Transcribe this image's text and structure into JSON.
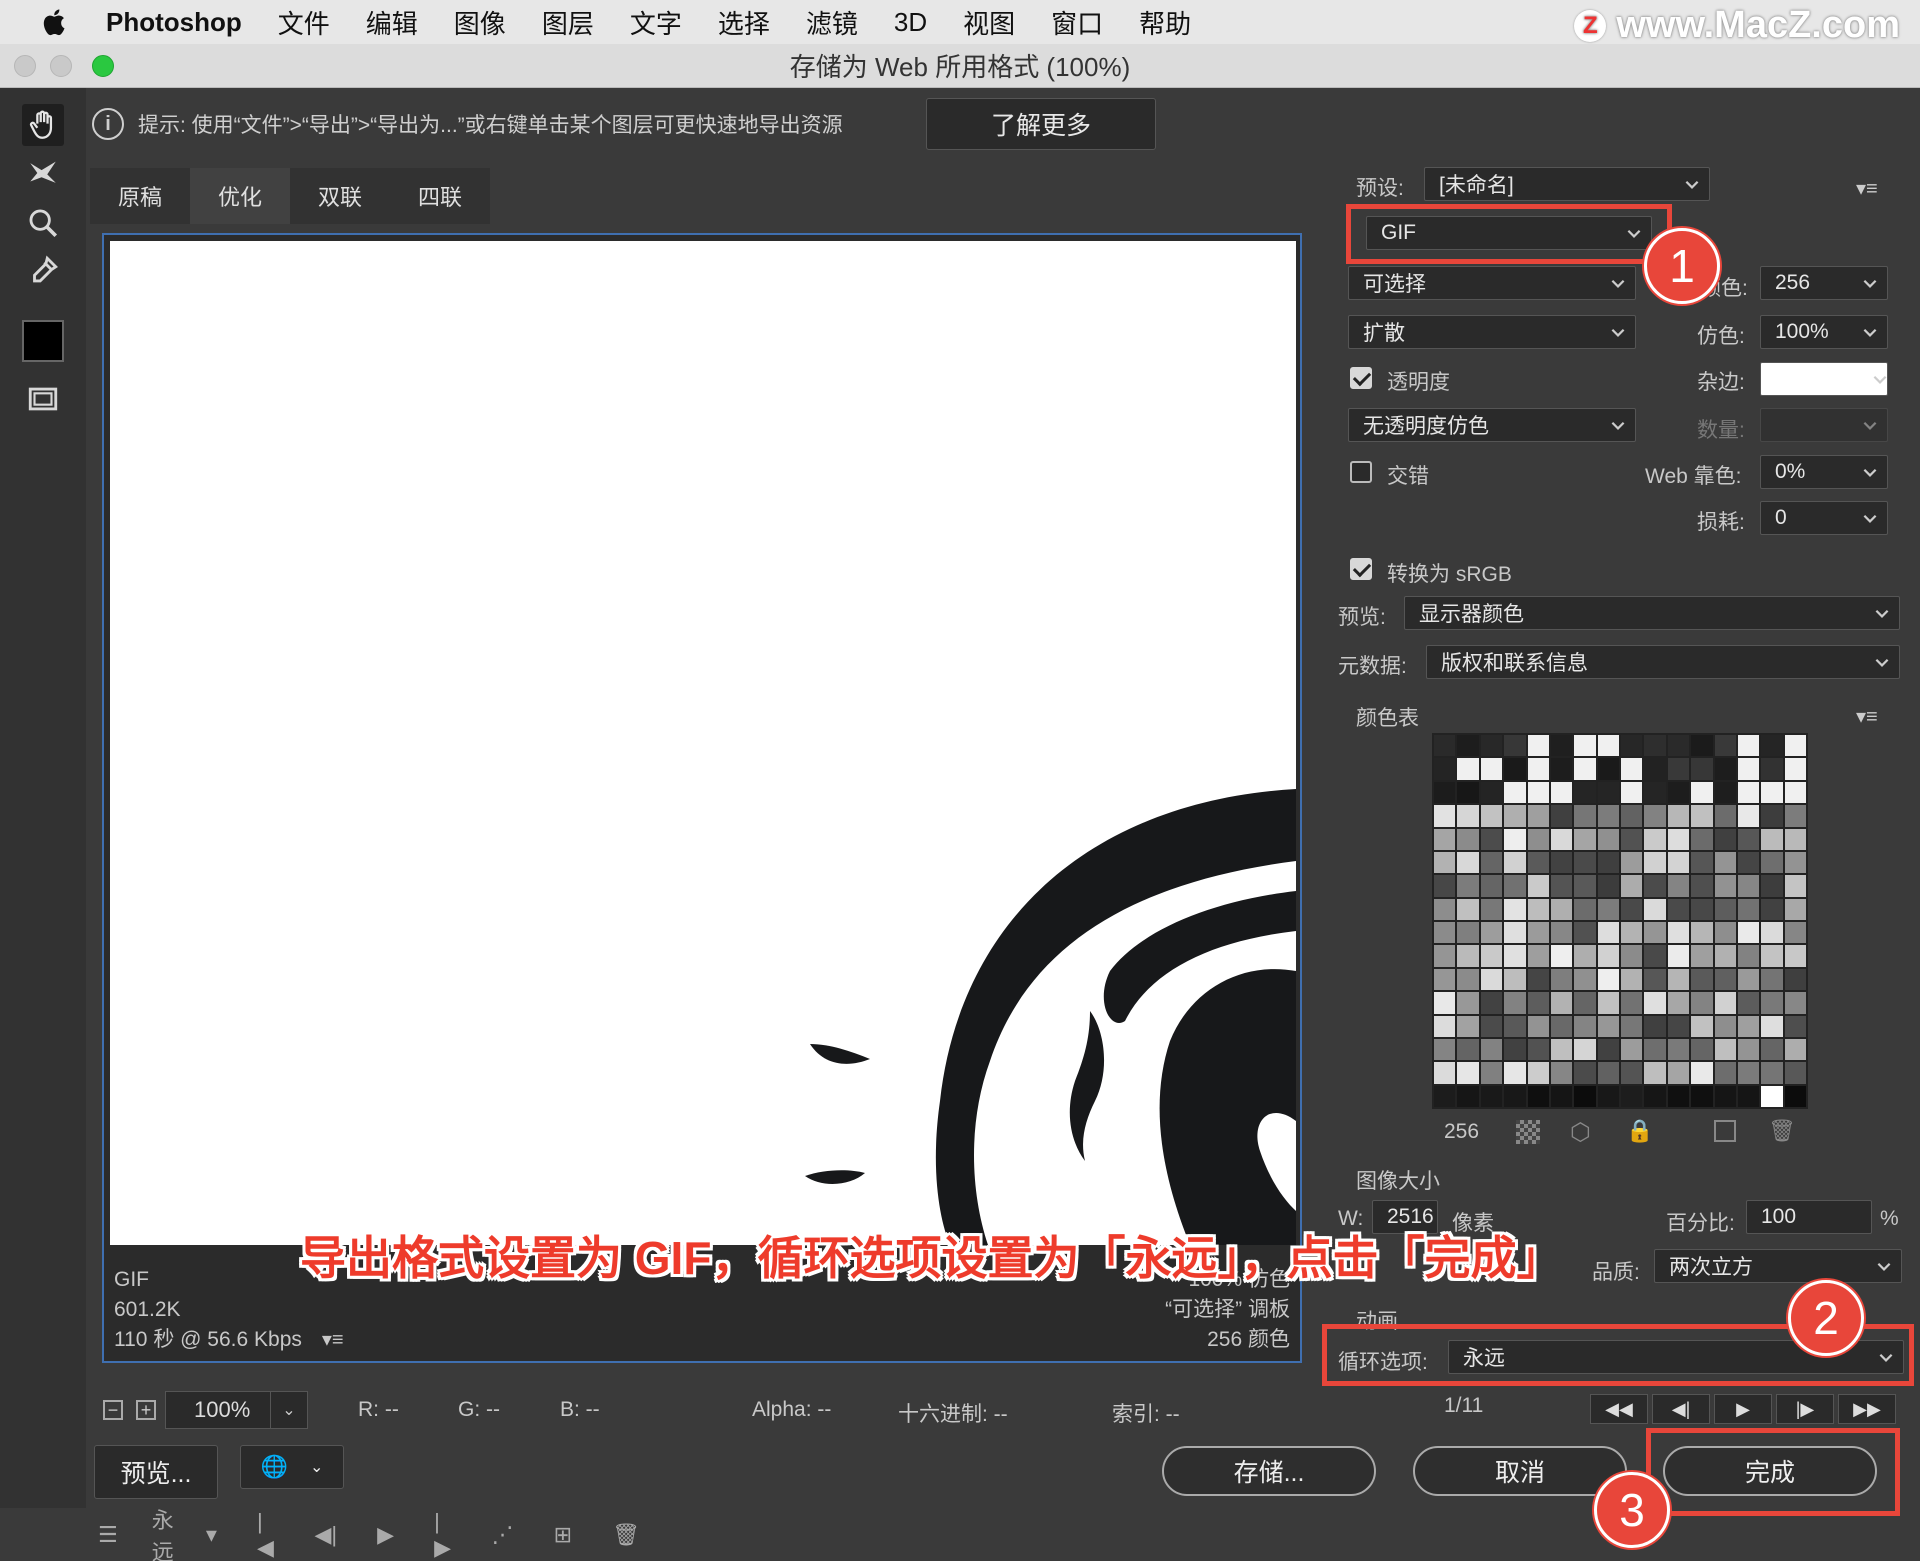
{
  "menubar": {
    "app": "Photoshop",
    "items": [
      "文件",
      "编辑",
      "图像",
      "图层",
      "文字",
      "选择",
      "滤镜",
      "3D",
      "视图",
      "窗口",
      "帮助"
    ],
    "watermark": "www.MacZ.com",
    "watermark_logo": "Z"
  },
  "window": {
    "title": "存储为 Web 所用格式 (100%)"
  },
  "hint": {
    "text": "提示: 使用“文件”>“导出”>“导出为...”或右键单击某个图层可更快速地导出资源",
    "button": "了解更多"
  },
  "tabs": [
    "原稿",
    "优化",
    "双联",
    "四联"
  ],
  "preview": {
    "format": "GIF",
    "size": "601.2K",
    "time": "110 秒 @ 56.6 Kbps",
    "right_line1": "100% 仿色",
    "right_line2": "“可选择” 调板",
    "right_line3": "256 颜色"
  },
  "caption": "导出格式设置为 GIF，循环选项设置为「永远」，点击「完成」",
  "status": {
    "zoom": "100%",
    "r": "R: --",
    "g": "G: --",
    "b": "B: --",
    "alpha": "Alpha: --",
    "hex": "十六进制: --",
    "index": "索引: --"
  },
  "buttons": {
    "preview": "预览...",
    "save": "存储...",
    "cancel": "取消",
    "done": "完成"
  },
  "settings": {
    "preset_label": "预设:",
    "preset_value": "[未命名]",
    "format": "GIF",
    "reduction": "可选择",
    "colors_label": "颜色:",
    "colors_value": "256",
    "dither_algo": "扩散",
    "dither_label": "仿色:",
    "dither_value": "100%",
    "transparency_label": "透明度",
    "matte_label": "杂边:",
    "trans_dither": "无透明度仿色",
    "amount_label": "数量:",
    "interlaced_label": "交错",
    "websnap_label": "Web 靠色:",
    "websnap_value": "0%",
    "lossy_label": "损耗:",
    "lossy_value": "0",
    "srgb_label": "转换为 sRGB",
    "preview_label": "预览:",
    "preview_value": "显示器颜色",
    "metadata_label": "元数据:",
    "metadata_value": "版权和联系信息",
    "colortable_label": "颜色表",
    "colortable_count": "256",
    "imagesize_label": "图像大小",
    "w_label": "W:",
    "w_value": "2516",
    "pixel_label": "像素",
    "percent_label": "百分比:",
    "percent_value": "100",
    "percent_unit": "%",
    "quality_label": "品质:",
    "quality_value": "两次立方",
    "anim_label": "动画",
    "loop_label": "循环选项:",
    "loop_value": "永远",
    "frame": "1/11"
  },
  "badges": [
    "1",
    "2",
    "3"
  ],
  "bottombar": {
    "loop": "永远"
  },
  "colors": {
    "accent_red": "#e8463a",
    "preview_border": "#3f6fb0"
  }
}
